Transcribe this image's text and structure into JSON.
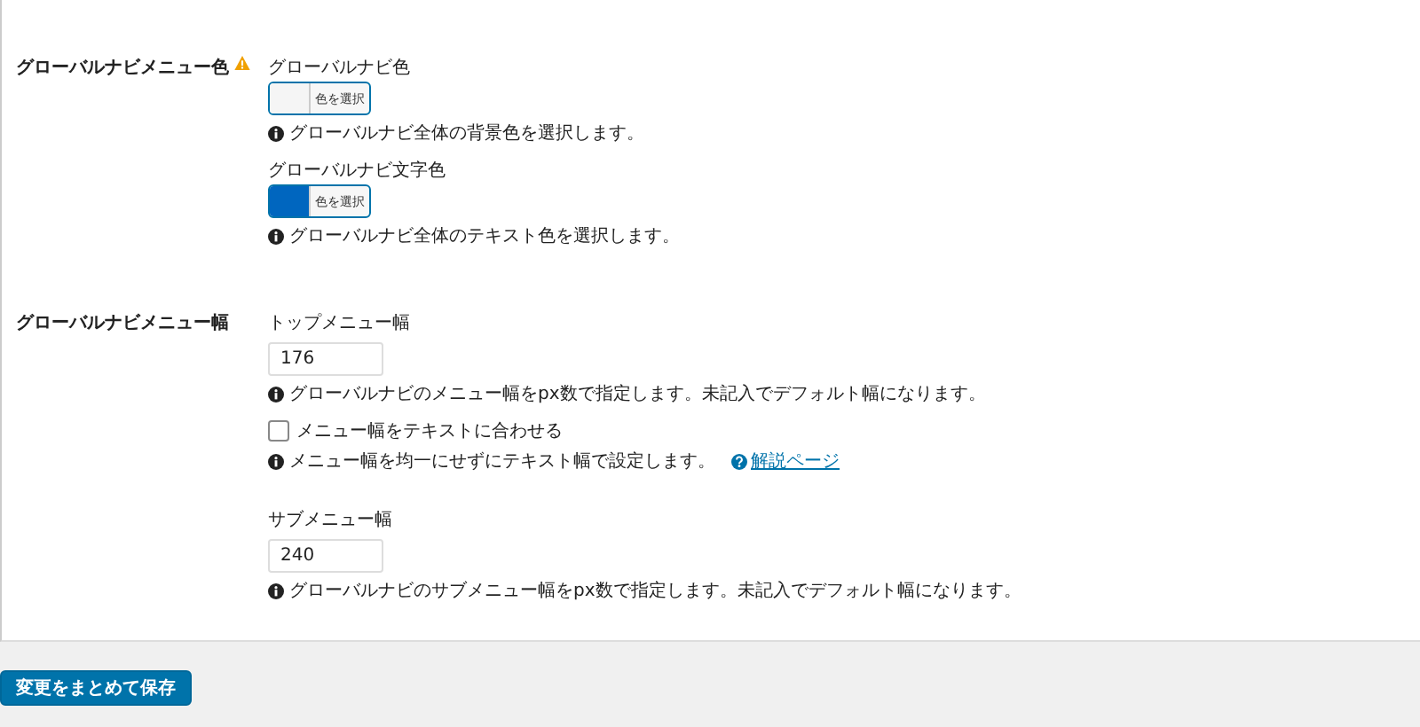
{
  "sections": [
    {
      "label": "グローバルナビメニュー色",
      "warning": true,
      "fields": [
        {
          "kind": "color",
          "label": "グローバルナビ色",
          "color": "#f5f5f5",
          "button": "色を選択",
          "help": "グローバルナビ全体の背景色を選択します。"
        },
        {
          "kind": "color",
          "label": "グローバルナビ文字色",
          "color": "#0066bf",
          "button": "色を選択",
          "help": "グローバルナビ全体のテキスト色を選択します。"
        }
      ]
    },
    {
      "label": "グローバルナビメニュー幅",
      "warning": false,
      "fields": [
        {
          "kind": "number",
          "label": "トップメニュー幅",
          "value": "176",
          "help": "グローバルナビのメニュー幅をpx数で指定します。未記入でデフォルト幅になります。"
        },
        {
          "kind": "checkbox",
          "label": "メニュー幅をテキストに合わせる",
          "checked": false,
          "help": "メニュー幅を均一にせずにテキスト幅で設定します。",
          "link": "解説ページ"
        },
        {
          "kind": "number",
          "label": "サブメニュー幅",
          "value": "240",
          "help": "グローバルナビのサブメニュー幅をpx数で指定します。未記入でデフォルト幅になります。"
        }
      ]
    }
  ],
  "save_button": "変更をまとめて保存"
}
